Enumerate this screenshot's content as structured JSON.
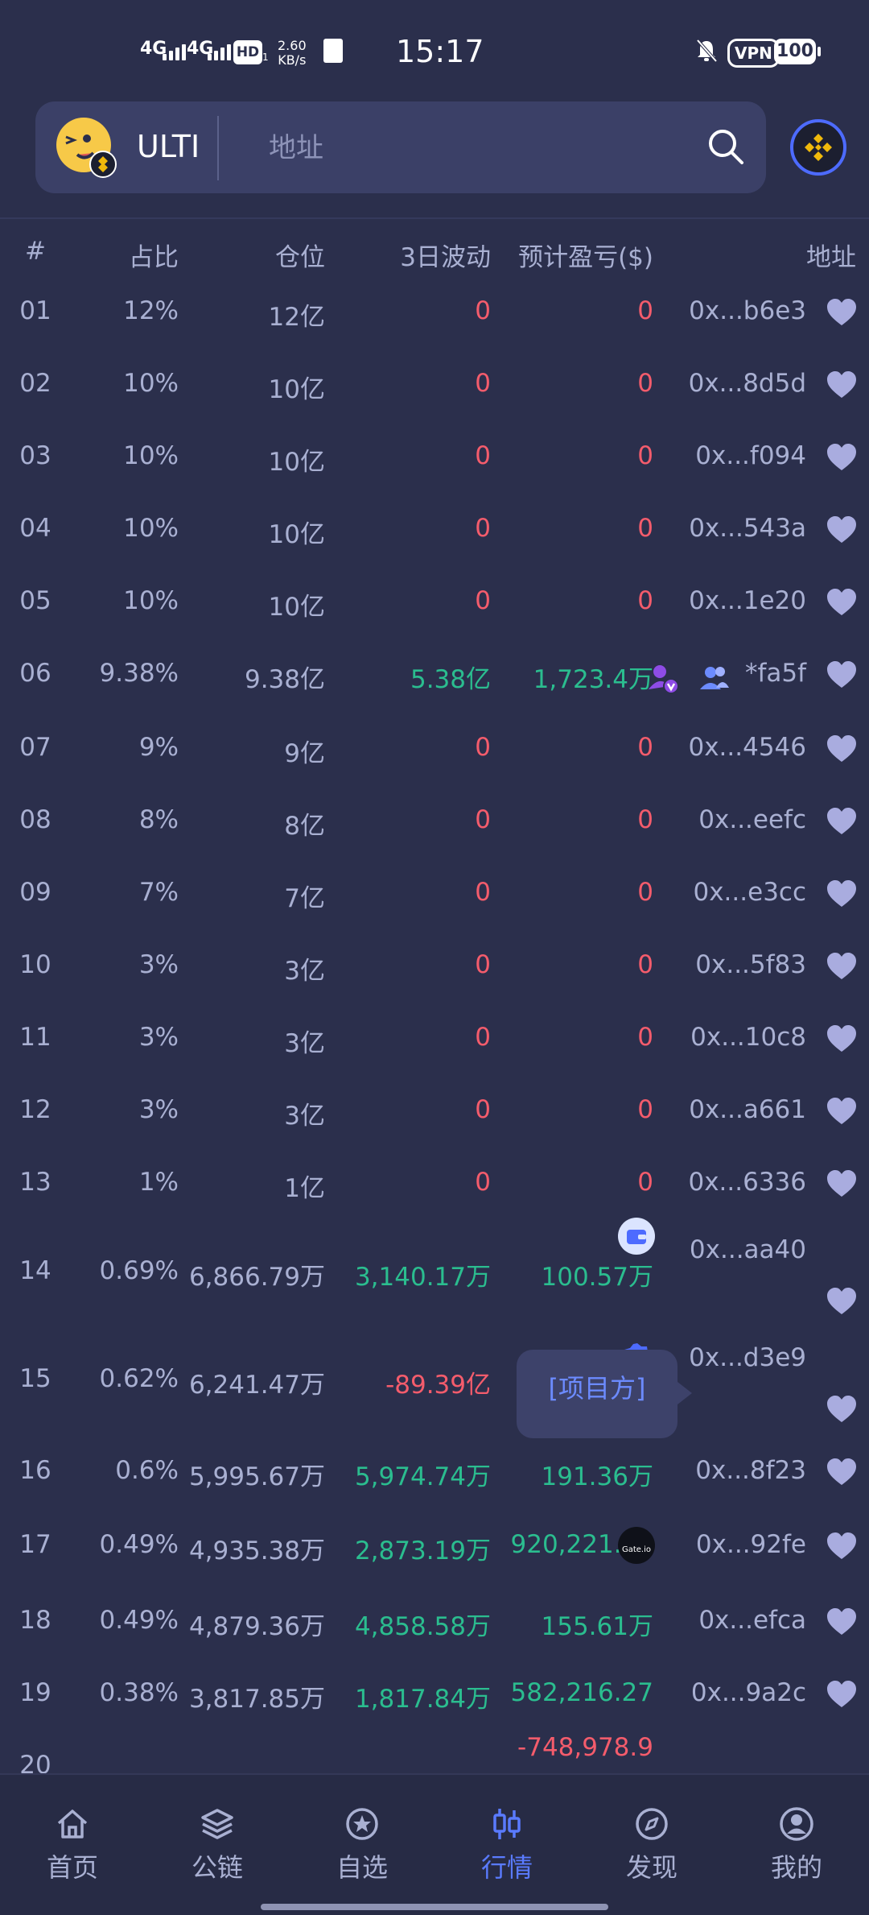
{
  "status_bar": {
    "sim1": "4G",
    "sim2": "4G",
    "hd": "HD",
    "hd_sub": "1",
    "speed_value": "2.60",
    "speed_unit": "KB/s",
    "time": "15:17",
    "vpn": "VPN",
    "battery": "100"
  },
  "search": {
    "token_name": "ULTI",
    "placeholder": "地址"
  },
  "table": {
    "headers": {
      "rank": "#",
      "share": "占比",
      "position": "仓位",
      "change_3d": "3日波动",
      "est_pnl": "预计盈亏($)",
      "address": "地址"
    },
    "rows": [
      {
        "rank": "01",
        "share": "12%",
        "position": "12亿",
        "change": "0",
        "pnl": "0",
        "address": "0x...b6e3"
      },
      {
        "rank": "02",
        "share": "10%",
        "position": "10亿",
        "change": "0",
        "pnl": "0",
        "address": "0x...8d5d"
      },
      {
        "rank": "03",
        "share": "10%",
        "position": "10亿",
        "change": "0",
        "pnl": "0",
        "address": "0x...f094"
      },
      {
        "rank": "04",
        "share": "10%",
        "position": "10亿",
        "change": "0",
        "pnl": "0",
        "address": "0x...543a"
      },
      {
        "rank": "05",
        "share": "10%",
        "position": "10亿",
        "change": "0",
        "pnl": "0",
        "address": "0x...1e20"
      },
      {
        "rank": "06",
        "share": "9.38%",
        "position": "9.38亿",
        "change": "5.38亿",
        "pnl": "1,723.4万",
        "address": "*fa5f"
      },
      {
        "rank": "07",
        "share": "9%",
        "position": "9亿",
        "change": "0",
        "pnl": "0",
        "address": "0x...4546"
      },
      {
        "rank": "08",
        "share": "8%",
        "position": "8亿",
        "change": "0",
        "pnl": "0",
        "address": "0x...eefc"
      },
      {
        "rank": "09",
        "share": "7%",
        "position": "7亿",
        "change": "0",
        "pnl": "0",
        "address": "0x...e3cc"
      },
      {
        "rank": "10",
        "share": "3%",
        "position": "3亿",
        "change": "0",
        "pnl": "0",
        "address": "0x...5f83"
      },
      {
        "rank": "11",
        "share": "3%",
        "position": "3亿",
        "change": "0",
        "pnl": "0",
        "address": "0x...10c8"
      },
      {
        "rank": "12",
        "share": "3%",
        "position": "3亿",
        "change": "0",
        "pnl": "0",
        "address": "0x...a661"
      },
      {
        "rank": "13",
        "share": "1%",
        "position": "1亿",
        "change": "0",
        "pnl": "0",
        "address": "0x...6336"
      },
      {
        "rank": "14",
        "share": "0.69%",
        "position": "6,866.79万",
        "change": "3,140.17万",
        "pnl": "100.57万",
        "address": "0x...aa40"
      },
      {
        "rank": "15",
        "share": "0.62%",
        "position": "6,241.47万",
        "change": "-89.39亿",
        "pnl": "",
        "address": "0x...d3e9"
      },
      {
        "rank": "16",
        "share": "0.6%",
        "position": "5,995.67万",
        "change": "5,974.74万",
        "pnl": "191.36万",
        "address": "0x...8f23"
      },
      {
        "rank": "17",
        "share": "0.49%",
        "position": "4,935.38万",
        "change": "2,873.19万",
        "pnl": "920,221.82",
        "address": "0x...92fe"
      },
      {
        "rank": "18",
        "share": "0.49%",
        "position": "4,879.36万",
        "change": "4,858.58万",
        "pnl": "155.61万",
        "address": "0x...efca"
      },
      {
        "rank": "19",
        "share": "0.38%",
        "position": "3,817.85万",
        "change": "1,817.84万",
        "pnl": "582,216.27",
        "address": "0x...9a2c"
      },
      {
        "rank": "20",
        "share": "",
        "position": "",
        "change": "",
        "pnl": "-748,978.9",
        "address": ""
      }
    ]
  },
  "tooltip": {
    "text": "[项目方]"
  },
  "exchange_badge": "Gate.io",
  "bottom_nav": {
    "items": [
      {
        "label": "首页",
        "icon": "home-icon"
      },
      {
        "label": "公链",
        "icon": "layers-icon"
      },
      {
        "label": "自选",
        "icon": "star-circle-icon"
      },
      {
        "label": "行情",
        "icon": "candlestick-icon"
      },
      {
        "label": "发现",
        "icon": "compass-icon"
      },
      {
        "label": "我的",
        "icon": "user-icon"
      }
    ],
    "active": "行情"
  },
  "colors": {
    "background": "#2b2f4c",
    "positive": "#2bbd8f",
    "negative": "#f45c6c",
    "accent": "#5a7bff",
    "heart": "#a9acdf"
  }
}
